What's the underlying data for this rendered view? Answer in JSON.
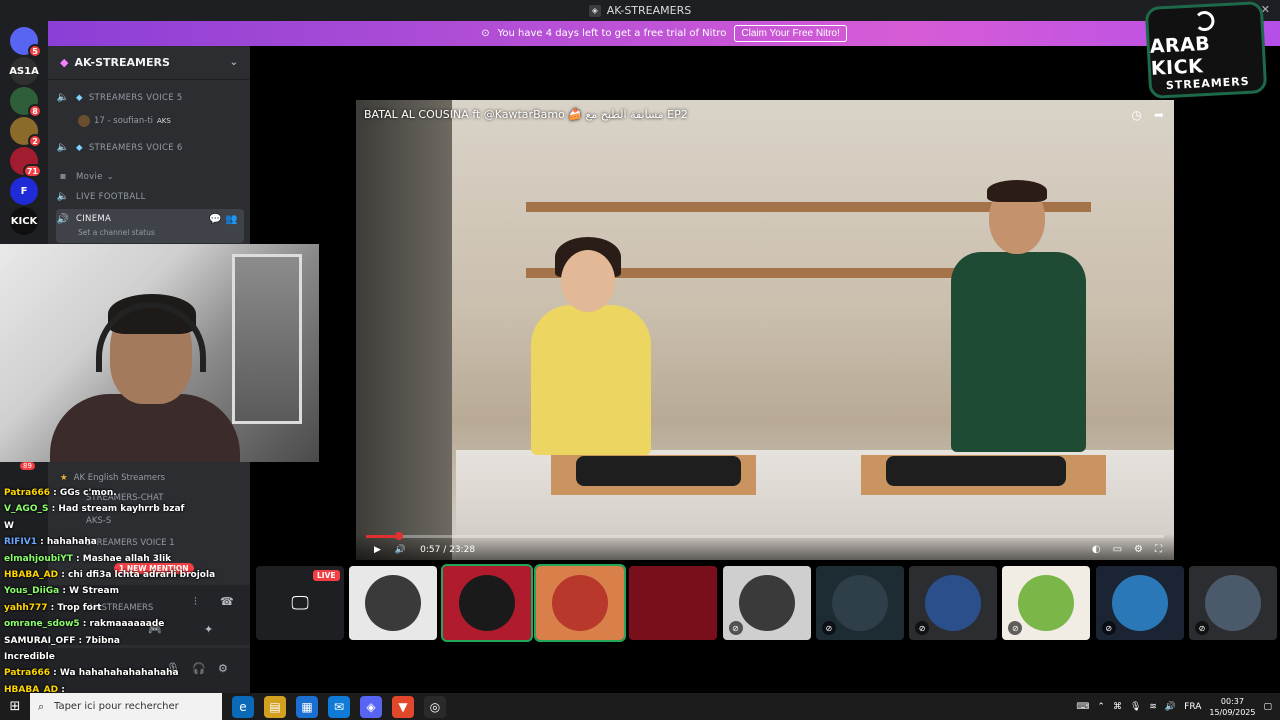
{
  "window": {
    "title": "AK-STREAMERS",
    "controls": [
      "–",
      "☐",
      "✕"
    ]
  },
  "nitro": {
    "message": "You have 4 days left to get a free trial of Nitro",
    "cta": "Claim Your Free Nitro!"
  },
  "server": {
    "name": "AK-STREAMERS"
  },
  "rail": [
    {
      "label": "",
      "badge": "5",
      "color": "#5865f2"
    },
    {
      "label": "AS1A",
      "badge": "",
      "color": "#2f2f2f"
    },
    {
      "label": "",
      "badge": "8",
      "color": "#2f5f3a"
    },
    {
      "label": "",
      "badge": "2",
      "color": "#8a6b2a"
    },
    {
      "label": "",
      "badge": "71",
      "color": "#a21c30"
    },
    {
      "label": "F",
      "badge": "",
      "color": "#1f2bd6"
    },
    {
      "label": "KICK",
      "badge": "",
      "color": "#0f0f0f"
    }
  ],
  "channels": [
    {
      "name": "STREAMERS VOICE 5",
      "icon": "speaker-icon"
    },
    {
      "name": "STREAMERS VOICE 6",
      "icon": "speaker-icon"
    },
    {
      "name": "Movie",
      "icon": "category"
    },
    {
      "name": "LIVE FOOTBALL",
      "icon": "speaker-icon"
    },
    {
      "name": "CINEMA",
      "icon": "speaker-icon",
      "status": "Set a channel status"
    }
  ],
  "voice_user": {
    "name": "17 - soufian-ti",
    "tag": "AKS"
  },
  "lower_channels": {
    "category": "AK English Streamers",
    "items": [
      "STREAMERS-CHAT",
      "AKS-S",
      "STREAMERS VOICE 1"
    ],
    "mention": "1 NEW MENTION",
    "server_label": "AK-STREAMERS"
  },
  "unread_badge": "89",
  "chat": [
    {
      "user": "Patra666",
      "text": "GGs c'mon.",
      "color": "#ffd700"
    },
    {
      "user": "V_AGO_S",
      "text": "Had stream kayhrrb bzaf",
      "color": "#8aff6a"
    },
    {
      "user": "",
      "text": "W",
      "color": "#ffffff"
    },
    {
      "user": "RIFIV1",
      "text": "hahahaha",
      "color": "#6aa8ff"
    },
    {
      "user": "elmahjoubiYT",
      "text": "Mashae allah 3lik",
      "color": "#8aff6a"
    },
    {
      "user": "HBABA_AD",
      "text": "chi dfi3a lchta adrarli brojola",
      "color": "#ffd700"
    },
    {
      "user": "Yous_DiiGa",
      "text": "W Stream",
      "color": "#8aff6a"
    },
    {
      "user": "yahh777",
      "text": "Trop fort",
      "color": "#ffd700"
    },
    {
      "user": "omrane_sdow5",
      "text": "rakmaaaaaade",
      "color": "#8aff6a"
    },
    {
      "user": "SAMURAI_OFF",
      "text": "7bibna",
      "color": "#ffffff"
    },
    {
      "user": "",
      "text": "Incredible",
      "color": "#ffffff"
    },
    {
      "user": "Patra666",
      "text": "Wa hahahahahahahaha",
      "color": "#ffd700"
    },
    {
      "user": "HBABA_AD",
      "text": "",
      "color": "#ffd700"
    }
  ],
  "video": {
    "title": "BATAL AL COUSINA ft @KawtarBamo 🍰 مسابقة الطبخ مع EP2",
    "time": "0:57 / 23:28",
    "progress_fraction": 0.041
  },
  "live_badge": "LIVE",
  "participants": [
    {
      "bg": "#1e1f22",
      "avatar": "#ffffff",
      "kind": "screen",
      "muted": false
    },
    {
      "bg": "#e8e8e8",
      "avatar": "#3a3a3a",
      "kind": "avatar",
      "muted": false
    },
    {
      "bg": "#b01c2e",
      "avatar": "#1a1a1a",
      "kind": "avatar",
      "muted": false,
      "selected": true
    },
    {
      "bg": "#d9804a",
      "avatar": "#b8382b",
      "kind": "avatar",
      "muted": false,
      "selected": true
    },
    {
      "bg": "#7a0f1c",
      "avatar": "#7a0f1c",
      "kind": "avatar",
      "muted": false
    },
    {
      "bg": "#cfcfcf",
      "avatar": "#3a3a3a",
      "kind": "avatar",
      "muted": true
    },
    {
      "bg": "#1d2b33",
      "avatar": "#2e3f4a",
      "kind": "avatar",
      "muted": true
    },
    {
      "bg": "#2b2d31",
      "avatar": "#2a4f8a",
      "kind": "avatar",
      "muted": true
    },
    {
      "bg": "#f1ece4",
      "avatar": "#7ab648",
      "kind": "avatar",
      "muted": true
    },
    {
      "bg": "#1b2433",
      "avatar": "#2a78b8",
      "kind": "avatar",
      "muted": true
    },
    {
      "bg": "#2b2d31",
      "avatar": "#4a5a6a",
      "kind": "avatar",
      "muted": true
    }
  ],
  "logo": {
    "line1": "ARAB KICK",
    "line2": "STREAMERS"
  },
  "taskbar": {
    "search_placeholder": "Taper ici pour rechercher",
    "lang": "FRA",
    "time": "00:37",
    "date": "15/09/2025"
  },
  "colors": {
    "discord_bg": "#2b2d31",
    "accent_red": "#f23f43"
  }
}
